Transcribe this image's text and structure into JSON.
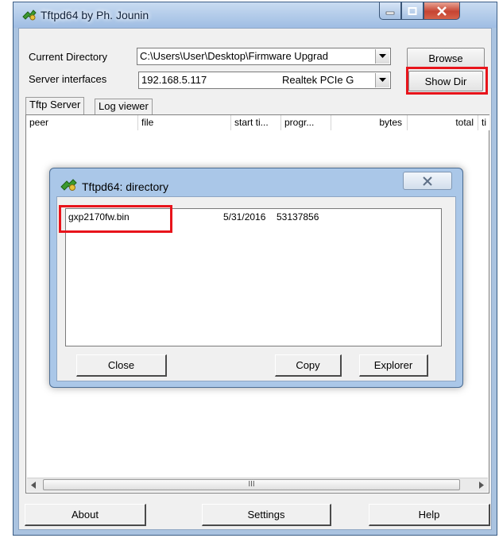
{
  "window": {
    "title": "Tftpd64 by Ph. Jounin"
  },
  "config": {
    "current_directory_label": "Current Directory",
    "current_directory_value": "C:\\Users\\User\\Desktop\\Firmware Upgrad",
    "server_interfaces_label": "Server interfaces",
    "server_ip": "192.168.5.117",
    "server_adapter": "Realtek PCIe G",
    "browse_label": "Browse",
    "show_dir_label": "Show Dir"
  },
  "tabs": [
    "Tftp Server",
    "Log viewer"
  ],
  "table": {
    "columns": [
      "peer",
      "file",
      "start ti...",
      "progr...",
      "bytes",
      "total",
      "ti"
    ]
  },
  "dialog": {
    "title": "Tftpd64: directory",
    "files": [
      {
        "name": "gxp2170fw.bin",
        "date": "5/31/2016",
        "size": "53137856"
      }
    ],
    "close_label": "Close",
    "copy_label": "Copy",
    "explorer_label": "Explorer"
  },
  "scrollbar": {
    "thumb_glyph": "III"
  },
  "footer": {
    "about_label": "About",
    "settings_label": "Settings",
    "help_label": "Help"
  },
  "colors": {
    "highlight_box": "#e8141b",
    "title_bar": "#aac3e0",
    "close_button": "#c64432"
  }
}
